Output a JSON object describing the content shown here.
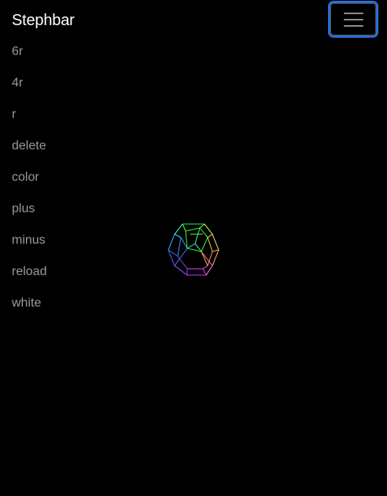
{
  "navbar": {
    "brand": "Stephbar",
    "toggler_icon": "hamburger-icon",
    "toggler_focus_color": "#2b6ed2"
  },
  "menu": {
    "items": [
      {
        "label": "6r"
      },
      {
        "label": "4r"
      },
      {
        "label": "r"
      },
      {
        "label": "delete"
      },
      {
        "label": "color"
      },
      {
        "label": "plus"
      },
      {
        "label": "minus"
      },
      {
        "label": "reload"
      },
      {
        "label": "white"
      }
    ]
  },
  "canvas": {
    "background": "#000000",
    "shape": "wireframe-dodecahedron",
    "edge_colors": [
      "#00ff66",
      "#33ff33",
      "#ccff33",
      "#ffcc33",
      "#ff66cc",
      "#cc33ff",
      "#6633ff",
      "#3399ff",
      "#33ccff"
    ]
  }
}
